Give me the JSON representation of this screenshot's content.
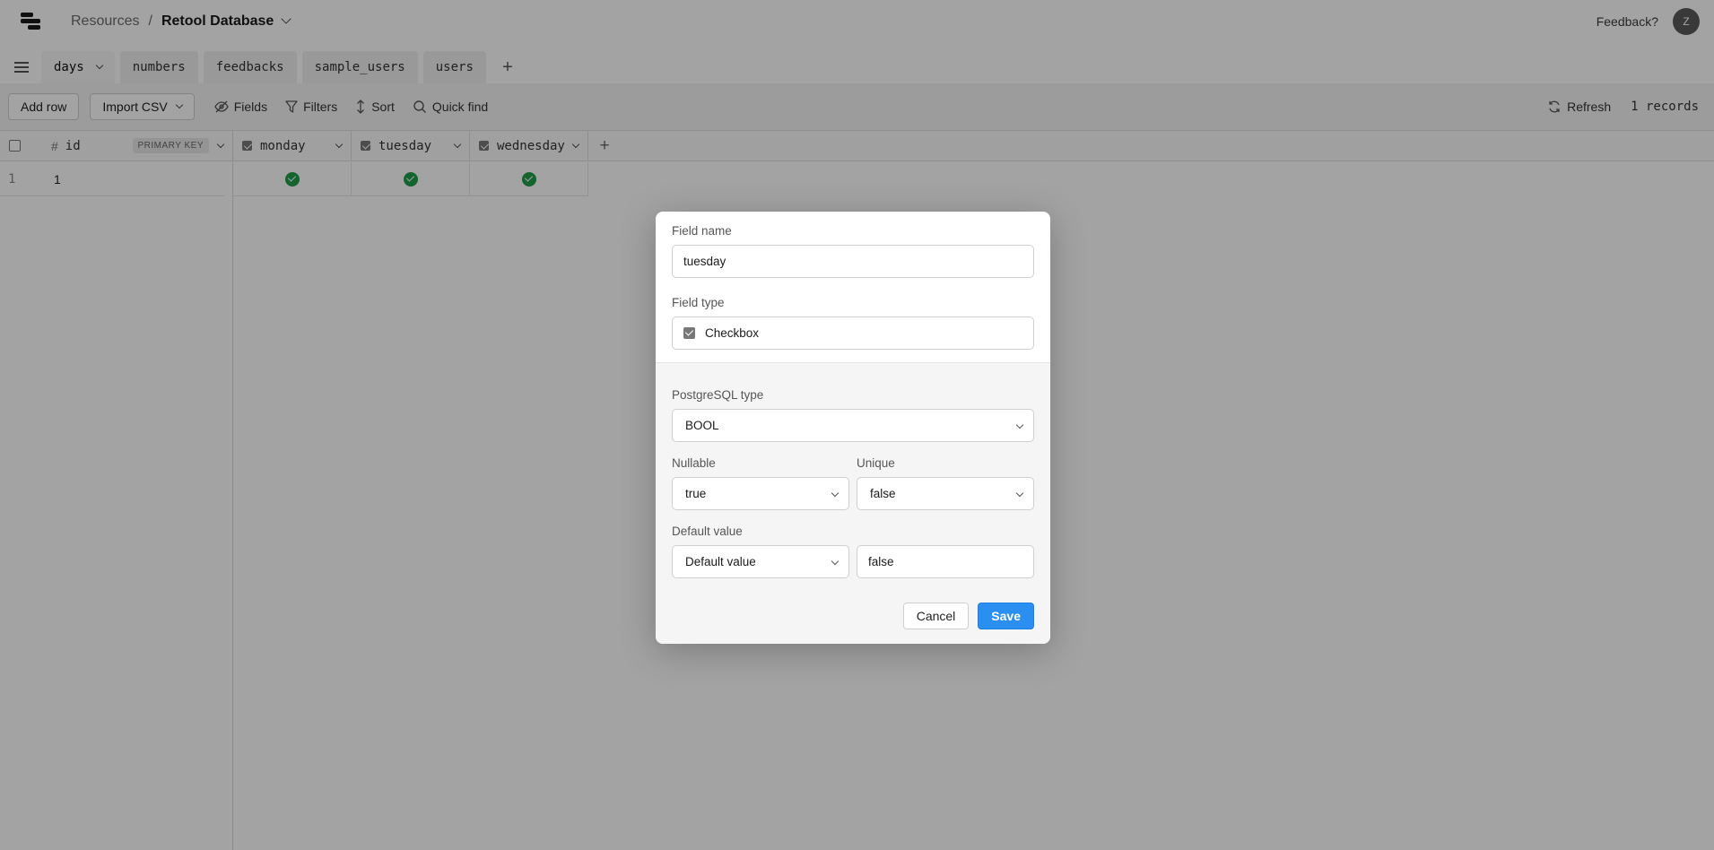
{
  "header": {
    "breadcrumb_root": "Resources",
    "breadcrumb_sep": "/",
    "breadcrumb_current": "Retool Database",
    "feedback": "Feedback?",
    "avatar_initial": "Z"
  },
  "tabs": [
    {
      "label": "days",
      "active": true
    },
    {
      "label": "numbers"
    },
    {
      "label": "feedbacks"
    },
    {
      "label": "sample_users"
    },
    {
      "label": "users"
    }
  ],
  "toolbar": {
    "add_row": "Add row",
    "import_csv": "Import CSV",
    "fields": "Fields",
    "filters": "Filters",
    "sort": "Sort",
    "quick_find": "Quick find",
    "refresh": "Refresh",
    "records": "1 records"
  },
  "grid": {
    "columns": [
      {
        "name": "id",
        "badge": "PRIMARY KEY"
      },
      {
        "name": "monday"
      },
      {
        "name": "tuesday"
      },
      {
        "name": "wednesday"
      }
    ],
    "rows": [
      {
        "row_num": "1",
        "id": "1",
        "monday": true,
        "tuesday": true,
        "wednesday": true
      }
    ]
  },
  "modal": {
    "field_name_label": "Field name",
    "field_name_value": "tuesday",
    "field_type_label": "Field type",
    "field_type_value": "Checkbox",
    "pg_type_label": "PostgreSQL type",
    "pg_type_value": "BOOL",
    "nullable_label": "Nullable",
    "nullable_value": "true",
    "unique_label": "Unique",
    "unique_value": "false",
    "default_label": "Default value",
    "default_mode": "Default value",
    "default_value": "false",
    "cancel": "Cancel",
    "save": "Save"
  },
  "colors": {
    "primary": "#2a8ff0",
    "check_green": "#1f9d4a"
  }
}
